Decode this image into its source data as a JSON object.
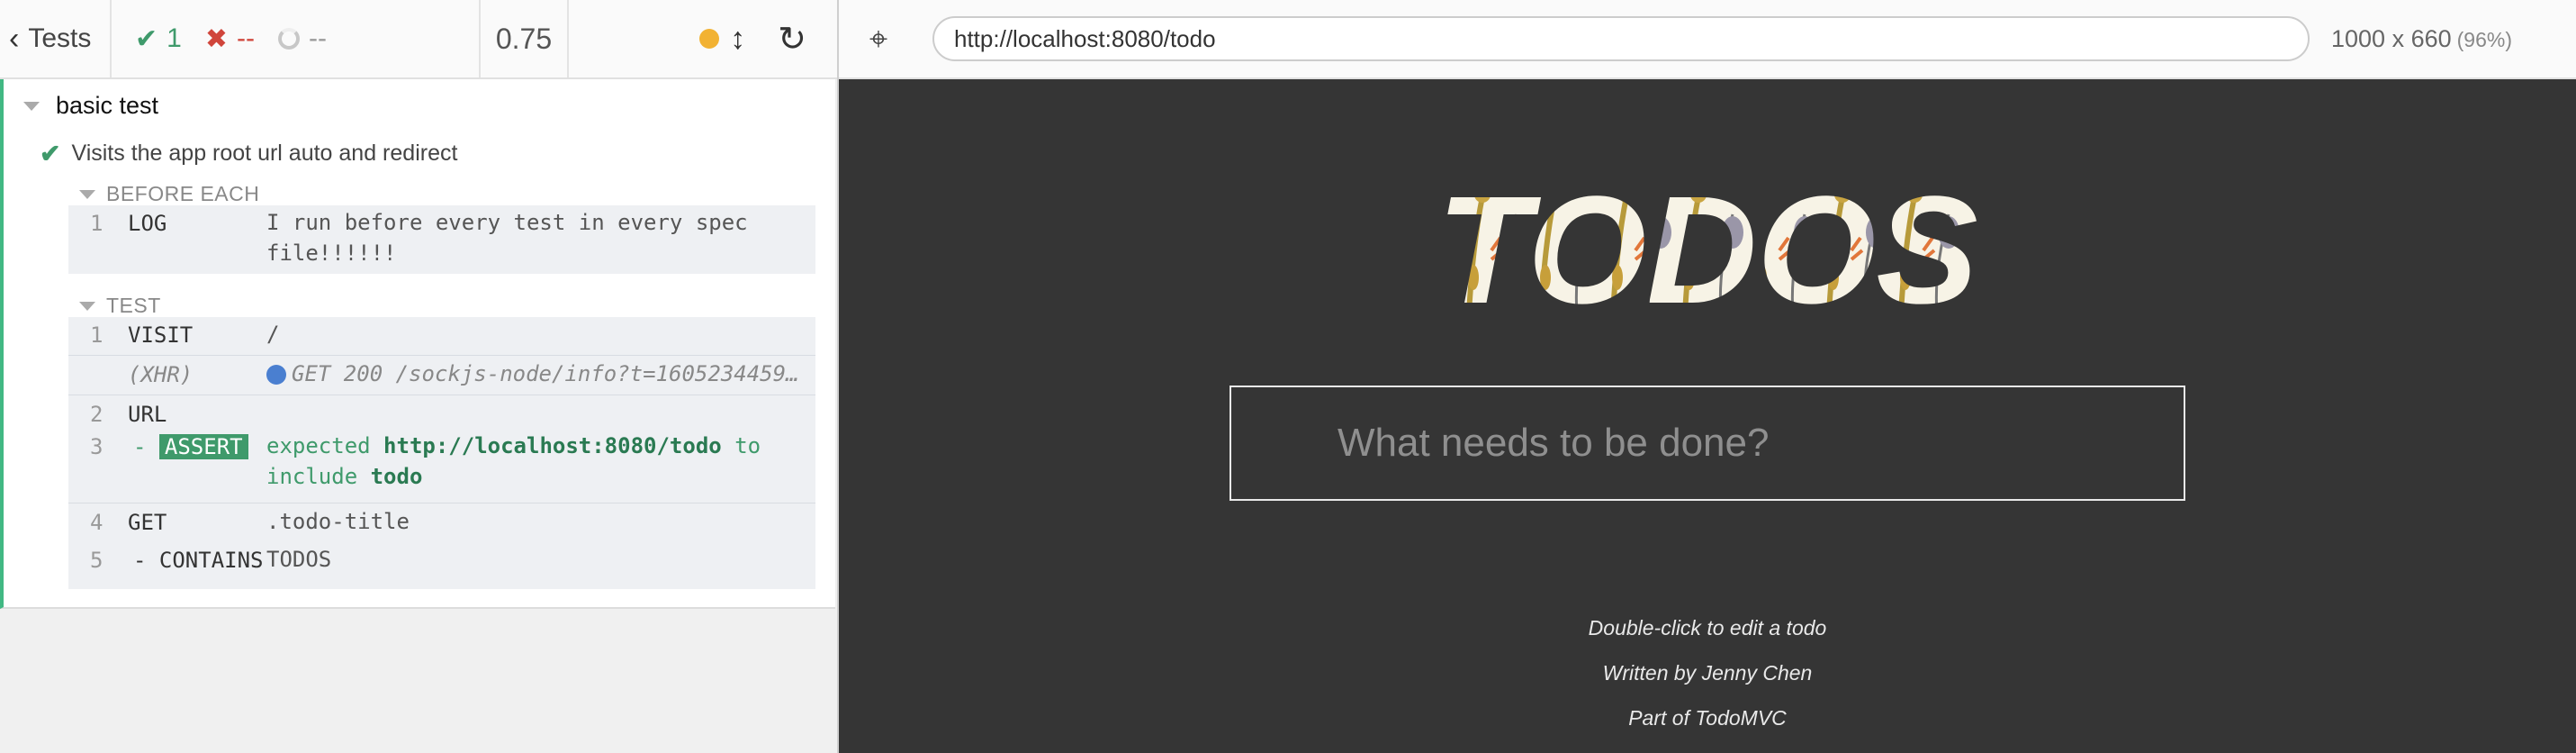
{
  "toolbar": {
    "tests_label": "Tests",
    "passed": "1",
    "failed": "--",
    "pending": "--",
    "duration": "0.75"
  },
  "browser": {
    "url": "http://localhost:8080/todo",
    "viewport": "1000 x 660",
    "zoom": "(96%)"
  },
  "reporter": {
    "suite": "basic test",
    "test": "Visits the app root url auto and redirect",
    "before_each_title": "BEFORE EACH",
    "before_each": [
      {
        "num": "1",
        "cmd": "LOG",
        "msg_line1": "I run before every test in every spec",
        "msg_line2": "file!!!!!!"
      }
    ],
    "test_title": "TEST",
    "commands": [
      {
        "num": "1",
        "cmd": "VISIT",
        "msg": "/"
      },
      {
        "num": "",
        "cmd": "(XHR)",
        "msg": "GET 200 /sockjs-node/info?t=1605234459…"
      },
      {
        "num": "2",
        "cmd": "URL",
        "msg": ""
      },
      {
        "num": "3",
        "cmd_prefix": "-",
        "cmd": "ASSERT",
        "msg_expected": "expected",
        "msg_url": "http://localhost:8080/todo",
        "msg_to": "to",
        "msg_include": "include",
        "msg_todo": "todo"
      },
      {
        "num": "4",
        "cmd": "GET",
        "msg": ".todo-title"
      },
      {
        "num": "5",
        "cmd_prefix": "-",
        "cmd": "CONTAINS",
        "msg": "TODOS"
      }
    ]
  },
  "app": {
    "title": "TODOS",
    "input_placeholder": "What needs to be done?",
    "footer": [
      "Double-click to edit a todo",
      "Written by Jenny Chen",
      "Part of TodoMVC"
    ]
  },
  "colors": {
    "pass": "#3f9a6b",
    "fail": "#d0453b",
    "running": "#f2b233",
    "app_bg": "#353535"
  }
}
